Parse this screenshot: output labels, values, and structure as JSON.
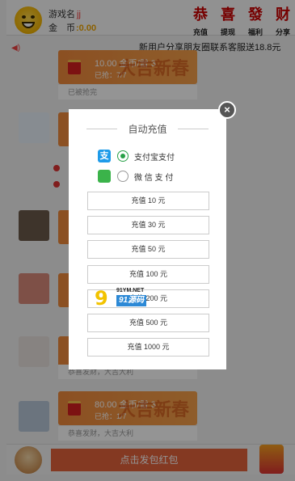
{
  "header": {
    "user_label": "游戏名",
    "user_value": "jj",
    "coin_label": "金　币",
    "coin_value": ":0.00",
    "nav": [
      {
        "label": "充值",
        "icon": "recharge-icon",
        "glyph": "恭"
      },
      {
        "label": "提现",
        "icon": "withdraw-icon",
        "glyph": "喜"
      },
      {
        "label": "福利",
        "icon": "welfare-icon",
        "glyph": "發"
      },
      {
        "label": "分享",
        "icon": "share-icon",
        "glyph": "财"
      }
    ],
    "marquee": "新用户分享朋友圈联系客服送18.8元"
  },
  "feed": {
    "claimed_caption": "已被抢完",
    "caption": "恭喜发财，大吉大利",
    "last_packet_amount": "80.00 金币/雷 3",
    "last_packet_sub": "已抢：1/7",
    "top_packet_amount": "10.00 金币/雷 3",
    "top_packet_sub": "已抢：7/7",
    "packet_art": "大吉新春"
  },
  "footer": {
    "send_label": "点击发包红包"
  },
  "dialog": {
    "close_glyph": "×",
    "title": "自动充值",
    "pay_options": [
      {
        "label": "支付宝支付",
        "icon": "alipay-icon",
        "color": "#1e9be9",
        "selected": true
      },
      {
        "label": "微 信 支 付",
        "icon": "wechat-icon",
        "color": "#3bb34a",
        "selected": false
      }
    ],
    "amounts": [
      "充值 10 元",
      "充值 30 元",
      "充值 50 元",
      "充值 100 元",
      "充值 200 元",
      "充值 500 元",
      "充值 1000 元"
    ]
  },
  "watermark": {
    "nine": "9",
    "url": "91YM.NET",
    "brand": "91源码"
  }
}
